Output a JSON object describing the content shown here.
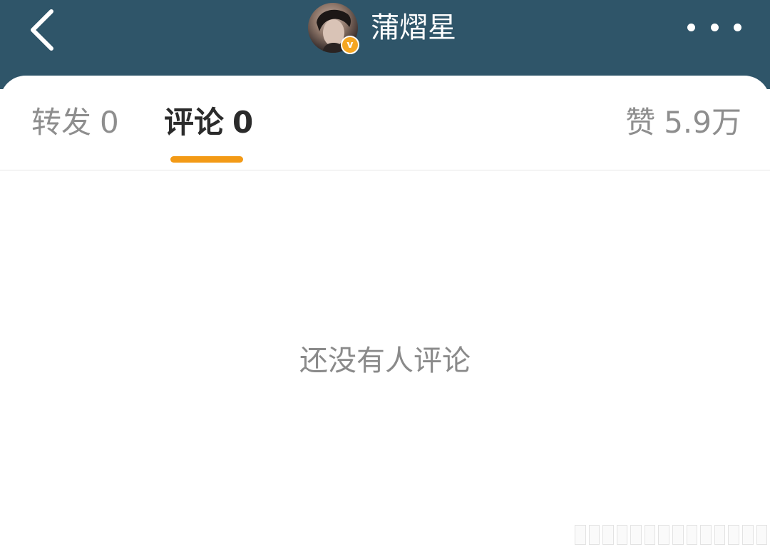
{
  "header": {
    "back_icon": "chevron-left-icon",
    "author_name": "蒲熠星",
    "verified_badge": "v",
    "more_icon": "more-horizontal-icon",
    "background_color": "#2f5569"
  },
  "tabs": [
    {
      "label": "转发",
      "count": "0",
      "active": false
    },
    {
      "label": "评论",
      "count": "0",
      "active": true
    },
    {
      "label": "赞",
      "count": "5.9万",
      "active": false
    }
  ],
  "accent_color": "#f39a16",
  "empty_state": {
    "message": "还没有人评论"
  }
}
